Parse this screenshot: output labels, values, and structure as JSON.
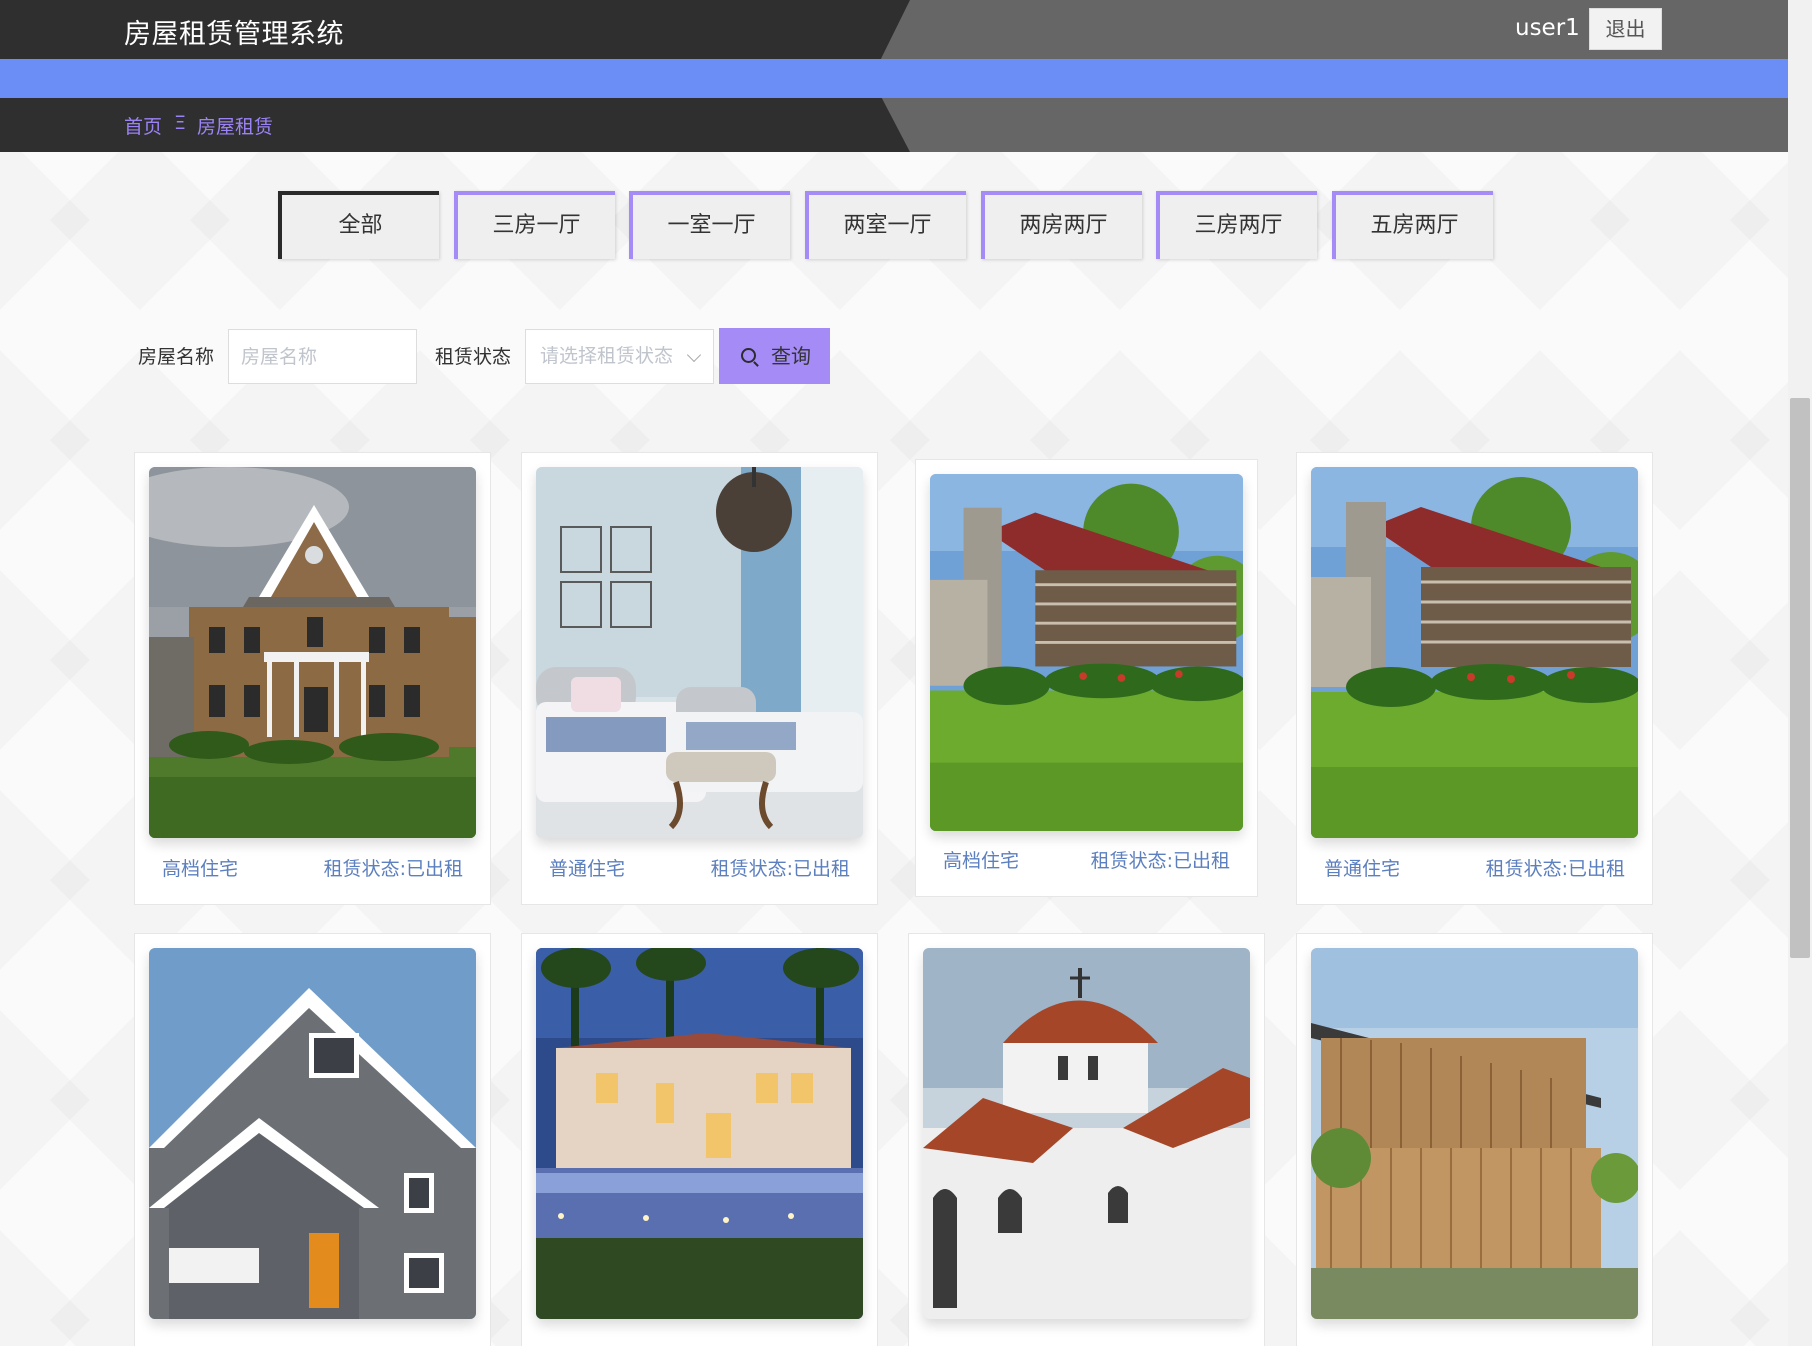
{
  "header": {
    "title": "房屋租赁管理系统",
    "username": "user1",
    "logout_label": "退出"
  },
  "breadcrumb": {
    "home": "首页",
    "separator": "Ξ",
    "current": "房屋租赁"
  },
  "tabs": [
    {
      "label": "全部",
      "active": true
    },
    {
      "label": "三房一厅",
      "active": false
    },
    {
      "label": "一室一厅",
      "active": false
    },
    {
      "label": "两室一厅",
      "active": false
    },
    {
      "label": "两房两厅",
      "active": false
    },
    {
      "label": "三房两厅",
      "active": false
    },
    {
      "label": "五房两厅",
      "active": false
    }
  ],
  "search": {
    "name_label": "房屋名称",
    "name_placeholder": "房屋名称",
    "status_label": "租赁状态",
    "status_placeholder": "请选择租赁状态",
    "button_label": "查询"
  },
  "listings": [
    {
      "type": "高档住宅",
      "status": "租赁状态:已出租",
      "image": "brick-colonial-house"
    },
    {
      "type": "普通住宅",
      "status": "租赁状态:已出租",
      "image": "twin-bedroom-interior"
    },
    {
      "type": "高档住宅",
      "status": "租赁状态:已出租",
      "image": "log-cabin-red-roof"
    },
    {
      "type": "普通住宅",
      "status": "租赁状态:已出租",
      "image": "log-cabin-red-roof"
    },
    {
      "type": "",
      "status": "",
      "image": "gray-craftsman-house"
    },
    {
      "type": "",
      "status": "",
      "image": "villa-pool-night"
    },
    {
      "type": "",
      "status": "",
      "image": "white-chapel-dome"
    },
    {
      "type": "",
      "status": "",
      "image": "modern-wood-house"
    }
  ],
  "colors": {
    "accent": "#a48bf5",
    "header_dark": "#2f2f2f",
    "header_gray": "#666666",
    "blue_bar": "#6a8ef5",
    "card_text": "#5c7fbf"
  }
}
